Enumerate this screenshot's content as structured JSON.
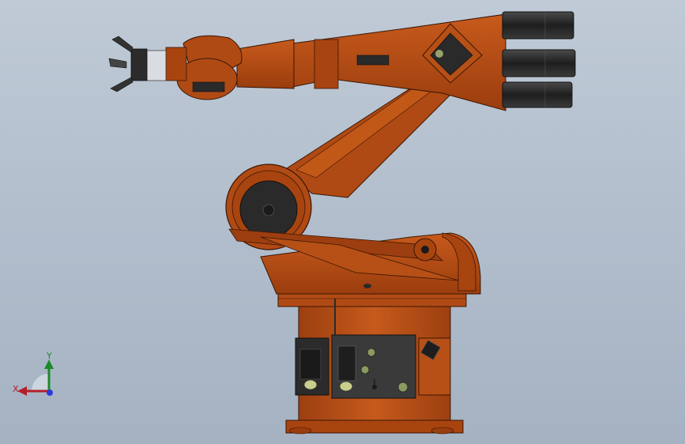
{
  "viewport": {
    "background_top": "#bfcad6",
    "background_bottom": "#a5b2c2"
  },
  "model": {
    "body_color": "#b04a14",
    "dark_part_color": "#2a2a2a",
    "outline_color": "#3a1605"
  },
  "triad": {
    "y_label": "Y",
    "x_label": "X",
    "y_color": "#1c8a2a",
    "x_color": "#b4202a",
    "z_color": "#2a3ad8"
  }
}
